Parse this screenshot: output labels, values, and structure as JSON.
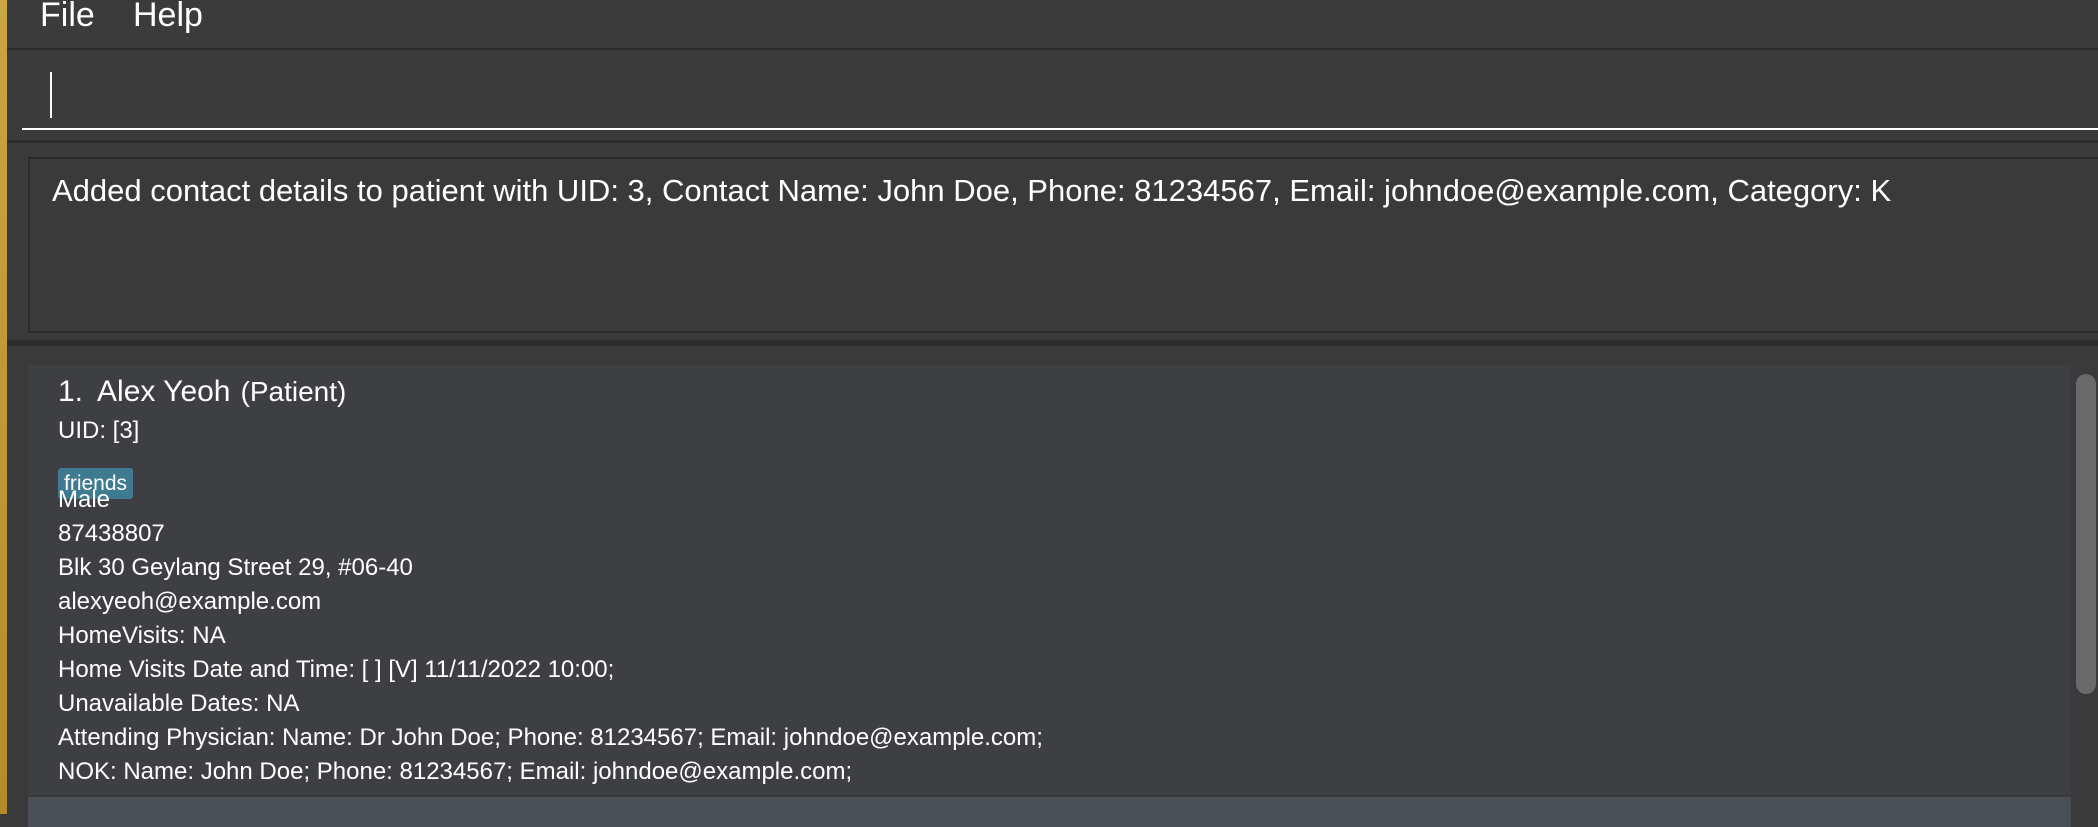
{
  "menu": {
    "file_label": "File",
    "help_label": "Help"
  },
  "command_box": {
    "value": "",
    "placeholder": ""
  },
  "result_display": {
    "text": "Added contact details to patient with UID: 3, Contact Name: John Doe, Phone: 81234567, Email: johndoe@example.com, Category: K"
  },
  "person_list": {
    "items": [
      {
        "index": "1.",
        "name": "Alex Yeoh",
        "role": "(Patient)",
        "uid": "UID: [3]",
        "tags": [
          "friends"
        ],
        "gender": "Male",
        "phone": "87438807",
        "address": "Blk 30 Geylang Street 29, #06-40",
        "email": "alexyeoh@example.com",
        "home_visits": "HomeVisits: NA",
        "home_visits_datetime": "Home Visits Date and Time: [ ] [V] 11/11/2022 10:00;",
        "unavailable_dates": "Unavailable Dates: NA",
        "attending_physician": "Attending Physician: Name: Dr John Doe; Phone: 81234567; Email: johndoe@example.com;",
        "nok": "NOK: Name: John Doe; Phone: 81234567; Email: johndoe@example.com;"
      }
    ]
  },
  "colors": {
    "background": "#3a3a3a",
    "tag": "#3e7b91",
    "text": "#ffffff"
  }
}
